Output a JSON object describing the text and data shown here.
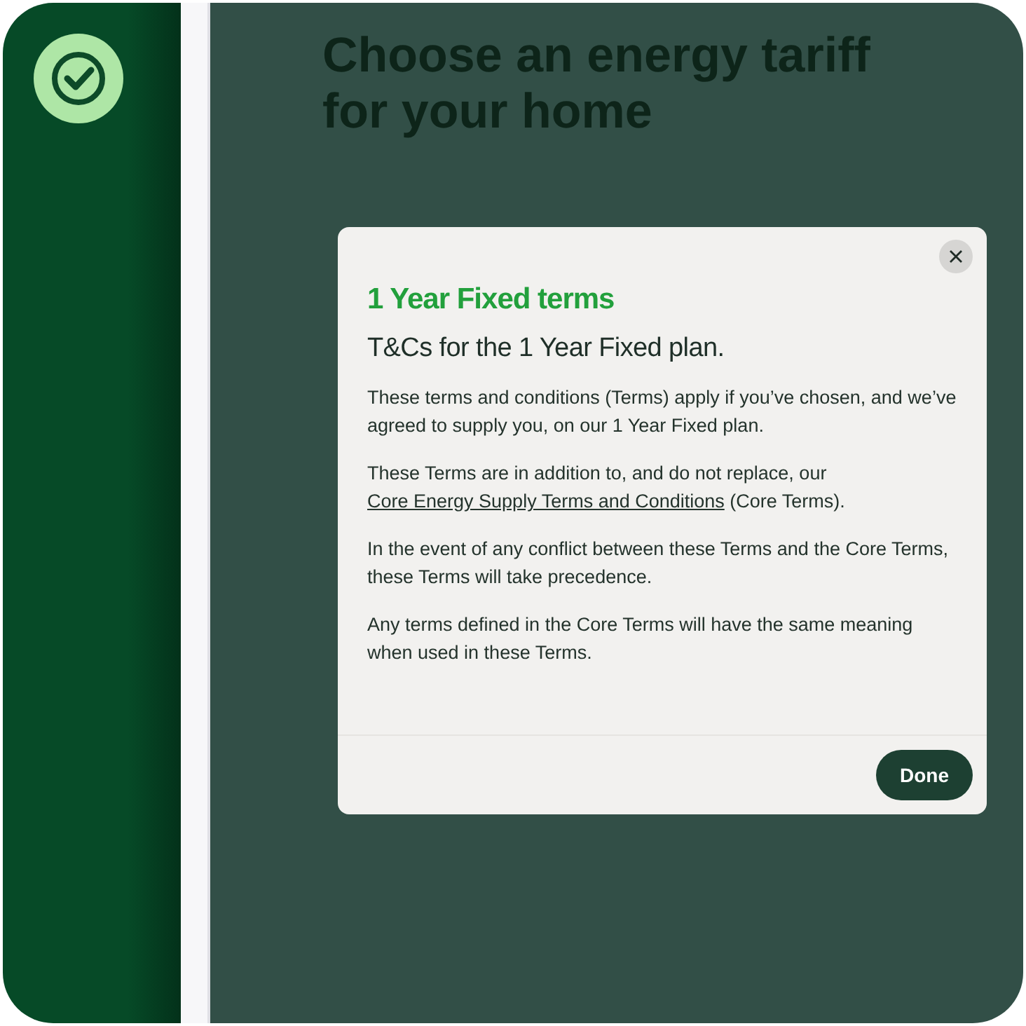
{
  "page": {
    "heading": "Choose an energy tariff for your home"
  },
  "modal": {
    "title": "1 Year Fixed terms",
    "subtitle": "T&Cs for the 1 Year Fixed plan.",
    "paragraphs": [
      {
        "kind": "text",
        "text": "These terms and conditions (Terms) apply if you’ve chosen, and we’ve agreed to supply you, on our 1 Year Fixed plan."
      },
      {
        "kind": "link",
        "before": "These Terms are in addition to, and do not replace, our ",
        "link": "Core Energy Supply Terms and Conditions",
        "after": " (Core Terms)."
      },
      {
        "kind": "text",
        "text": "In the event of any conflict between these Terms and the Core Terms, these Terms will take precedence."
      },
      {
        "kind": "text",
        "text": "Any terms defined in the Core Terms will have the same meaning when used in these Terms."
      }
    ],
    "button": "Done"
  }
}
